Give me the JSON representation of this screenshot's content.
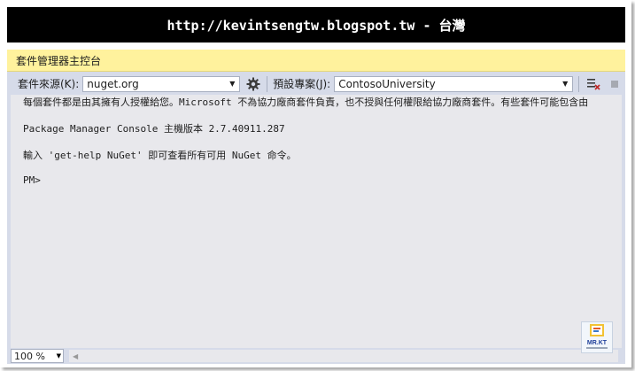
{
  "banner": {
    "text": "http://kevintsengtw.blogspot.tw - 台灣"
  },
  "window": {
    "title": "套件管理器主控台"
  },
  "toolbar": {
    "source_label": "套件來源(K):",
    "source_value": "nuget.org",
    "project_label": "預設專案(J):",
    "project_value": "ContosoUniversity"
  },
  "console": {
    "lines": [
      "每個套件都是由其擁有人授權給您。Microsoft 不為協力廠商套件負責，也不授與任何權限給協力廠商套件。有些套件可能包含由",
      "Package Manager Console 主機版本 2.7.40911.287",
      "輸入 'get-help NuGet' 即可查看所有可用 NuGet 命令。",
      "PM>"
    ]
  },
  "status": {
    "zoom": "100 %"
  },
  "logo": {
    "text": "MR.KT"
  },
  "colors": {
    "titlebar": "#fff29d",
    "toolbar": "#d6dbe9",
    "console_bg": "#e8e8ec",
    "banner_bg": "#000000"
  }
}
